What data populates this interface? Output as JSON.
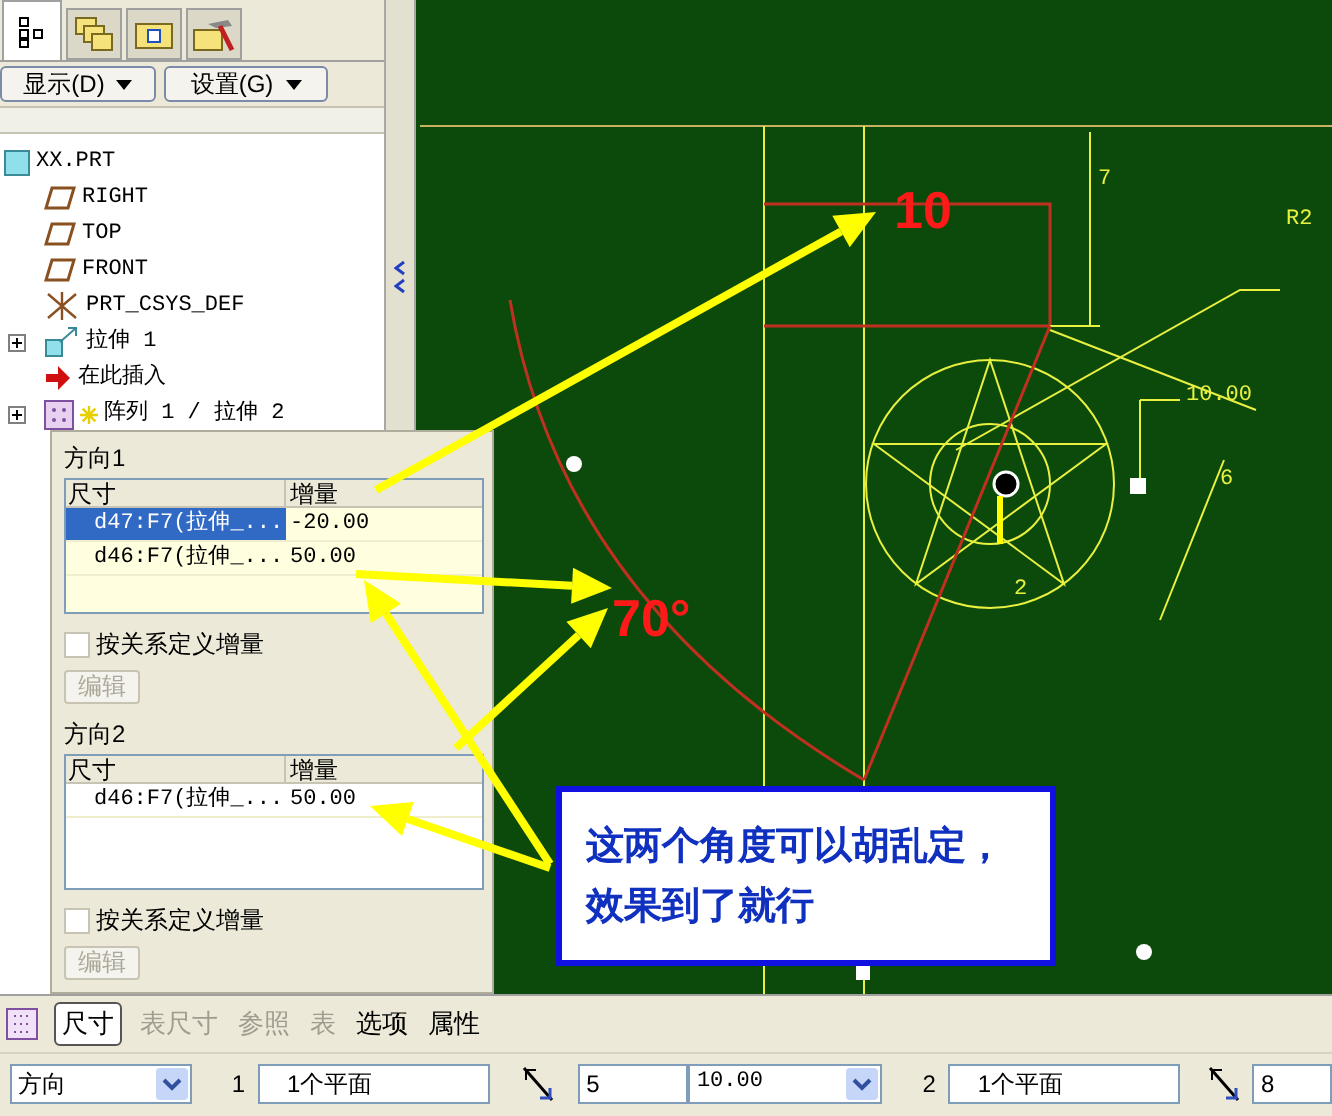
{
  "model_tree": {
    "tabs": [
      {
        "kind": "tree",
        "selected": true
      },
      {
        "kind": "layers",
        "selected": false
      },
      {
        "kind": "folder",
        "selected": false
      },
      {
        "kind": "tools",
        "selected": false
      }
    ],
    "buttons": [
      {
        "label": "显示(D)"
      },
      {
        "label": "设置(G)"
      }
    ],
    "root": {
      "label": "XX.PRT",
      "kind": "part",
      "children": [
        {
          "label": "RIGHT",
          "kind": "plane",
          "collapsed": false,
          "flagged": false
        },
        {
          "label": "TOP",
          "kind": "plane",
          "collapsed": false,
          "flagged": false
        },
        {
          "label": "FRONT",
          "kind": "plane",
          "collapsed": false,
          "flagged": false
        },
        {
          "label": "PRT_CSYS_DEF",
          "kind": "csys",
          "collapsed": false,
          "flagged": false
        },
        {
          "label": "拉伸 1",
          "kind": "extrude",
          "collapsed": true,
          "flagged": false
        },
        {
          "label": "在此插入",
          "kind": "insert",
          "collapsed": false,
          "flagged": false
        },
        {
          "label": "阵列 1 / 拉伸 2",
          "kind": "pattern",
          "collapsed": true,
          "flagged": true
        }
      ]
    }
  },
  "pattern_panel": {
    "directions": [
      {
        "title": "方向1",
        "active": true,
        "columns": [
          "尺寸",
          "增量"
        ],
        "rows": [
          {
            "dimension": "d47:F7(拉伸_...",
            "increment": "-20.00",
            "selected": true
          },
          {
            "dimension": "d46:F7(拉伸_...",
            "increment": "50.00",
            "selected": false
          }
        ],
        "checkbox": {
          "label": "按关系定义增量",
          "checked": false
        },
        "button": {
          "label": "编辑",
          "disabled": true
        }
      },
      {
        "title": "方向2",
        "active": false,
        "columns": [
          "尺寸",
          "增量"
        ],
        "rows": [
          {
            "dimension": "d46:F7(拉伸_...",
            "increment": "50.00",
            "selected": false
          }
        ],
        "checkbox": {
          "label": "按关系定义增量",
          "checked": false
        },
        "button": {
          "label": "编辑",
          "disabled": true
        }
      }
    ]
  },
  "canvas": {
    "labels": [
      {
        "text": "10",
        "kind": "highlight"
      },
      {
        "text": "70°",
        "kind": "highlight"
      },
      {
        "text": "7",
        "kind": "dimension"
      },
      {
        "text": "R2",
        "kind": "dimension"
      },
      {
        "text": "10.00",
        "kind": "dimension"
      },
      {
        "text": "6",
        "kind": "dimension"
      },
      {
        "text": "2",
        "kind": "dimension"
      }
    ]
  },
  "callout": {
    "text": "这两个角度可以胡乱定，效果到了就行"
  },
  "dashboard": {
    "tabs": [
      {
        "label": "尺寸",
        "selected": true,
        "disabled": false
      },
      {
        "label": "表尺寸",
        "selected": false,
        "disabled": true
      },
      {
        "label": "参照",
        "selected": false,
        "disabled": true
      },
      {
        "label": "表",
        "selected": false,
        "disabled": true
      },
      {
        "label": "选项",
        "selected": false,
        "disabled": false
      },
      {
        "label": "属性",
        "selected": false,
        "disabled": false
      }
    ],
    "direction_select": "方向",
    "ref1": {
      "index": "1",
      "value": "1个平面"
    },
    "count1": "5",
    "spacing1": "10.00",
    "ref2": {
      "index": "2",
      "value": "1个平面"
    },
    "count2": "8"
  }
}
